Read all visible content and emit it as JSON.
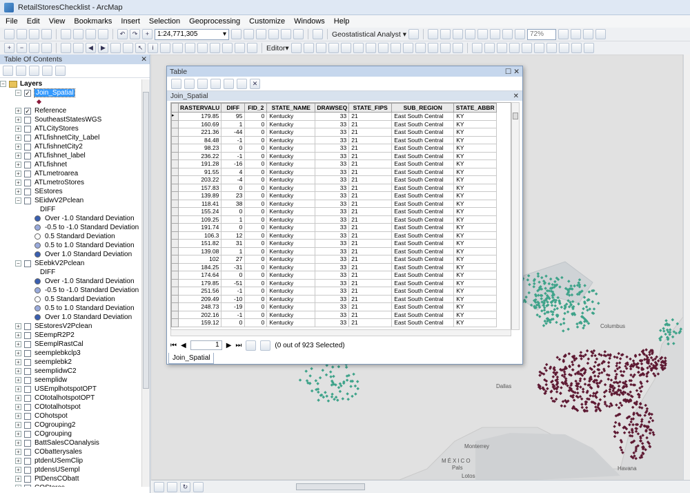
{
  "window": {
    "title": "RetailStoresChecklist - ArcMap"
  },
  "menu": [
    "File",
    "Edit",
    "View",
    "Bookmarks",
    "Insert",
    "Selection",
    "Geoprocessing",
    "Customize",
    "Windows",
    "Help"
  ],
  "toolbar": {
    "scale": "1:24,771,305",
    "geostat_label": "Geostatistical Analyst ▾",
    "zoom_percent": "72%",
    "editor_label": "Editor▾"
  },
  "toc": {
    "title": "Table Of Contents",
    "items": [
      {
        "label": "Layers",
        "kind": "group",
        "bold": true
      },
      {
        "label": "Join_Spatial",
        "kind": "layer",
        "checked": true,
        "expanded": true,
        "selected": true,
        "indent": 1
      },
      {
        "label": "",
        "kind": "point-symbol",
        "color": "#8b1a3a",
        "indent": 3
      },
      {
        "label": "Reference",
        "kind": "layer",
        "checked": true,
        "indent": 1
      },
      {
        "label": "SoutheastStatesWGS",
        "kind": "layer",
        "indent": 1
      },
      {
        "label": "ATLCityStores",
        "kind": "layer",
        "indent": 1
      },
      {
        "label": "ATLfishnetCity_Label",
        "kind": "layer",
        "indent": 1
      },
      {
        "label": "ATLfishnetCity2",
        "kind": "layer",
        "indent": 1
      },
      {
        "label": "ATLfishnet_label",
        "kind": "layer",
        "indent": 1
      },
      {
        "label": "ATLfishnet",
        "kind": "layer",
        "indent": 1
      },
      {
        "label": "ATLmetroarea",
        "kind": "layer",
        "indent": 1
      },
      {
        "label": "ATLmetroStores",
        "kind": "layer",
        "indent": 1
      },
      {
        "label": "SEstores",
        "kind": "layer",
        "indent": 1
      },
      {
        "label": "SEidwV2Pclean",
        "kind": "layer",
        "expanded": true,
        "indent": 1
      },
      {
        "label": "DIFF",
        "kind": "header",
        "indent": 3
      },
      {
        "label": "Over -1.0 Standard Deviation",
        "kind": "legend",
        "color": "#3a5fb0",
        "indent": 3
      },
      {
        "label": "-0.5 to -1.0 Standard Deviation",
        "kind": "legend",
        "color": "#9aabdc",
        "indent": 3
      },
      {
        "label": "0.5 Standard Deviation",
        "kind": "legend",
        "color": "#ffffff",
        "indent": 3
      },
      {
        "label": "0.5 to 1.0 Standard Deviation",
        "kind": "legend",
        "color": "#9aabdc",
        "indent": 3
      },
      {
        "label": "Over 1.0 Standard Deviation",
        "kind": "legend",
        "color": "#3a5fb0",
        "indent": 3
      },
      {
        "label": "SEebkV2Pclean",
        "kind": "layer",
        "expanded": true,
        "indent": 1
      },
      {
        "label": "DIFF",
        "kind": "header",
        "indent": 3
      },
      {
        "label": "Over -1.0 Standard Deviation",
        "kind": "legend",
        "color": "#3a5fb0",
        "indent": 3
      },
      {
        "label": "-0.5 to -1.0 Standard Deviation",
        "kind": "legend",
        "color": "#9aabdc",
        "indent": 3
      },
      {
        "label": "0.5 Standard Deviation",
        "kind": "legend",
        "color": "#ffffff",
        "indent": 3
      },
      {
        "label": "0.5  to 1.0 Standard Deviation",
        "kind": "legend",
        "color": "#9aabdc",
        "indent": 3
      },
      {
        "label": "Over 1.0 Standard Deviation",
        "kind": "legend",
        "color": "#3a5fb0",
        "indent": 3
      },
      {
        "label": "SEstoresV2Pclean",
        "kind": "layer",
        "indent": 1
      },
      {
        "label": "SEempR2P2",
        "kind": "layer",
        "indent": 1
      },
      {
        "label": "SEemplRastCal",
        "kind": "layer",
        "indent": 1
      },
      {
        "label": "seemplebkclp3",
        "kind": "layer",
        "indent": 1
      },
      {
        "label": "seemplebk2",
        "kind": "layer",
        "indent": 1
      },
      {
        "label": "seempIidwC2",
        "kind": "layer",
        "indent": 1
      },
      {
        "label": "seemplidw",
        "kind": "layer",
        "indent": 1
      },
      {
        "label": "USEmplhotspotOPT",
        "kind": "layer",
        "indent": 1
      },
      {
        "label": "COtotalhotspotOPT",
        "kind": "layer",
        "indent": 1
      },
      {
        "label": "COtotalhotspot",
        "kind": "layer",
        "indent": 1
      },
      {
        "label": "COhotspot",
        "kind": "layer",
        "indent": 1
      },
      {
        "label": "COgrouping2",
        "kind": "layer",
        "indent": 1
      },
      {
        "label": "COgrouping",
        "kind": "layer",
        "indent": 1
      },
      {
        "label": "BattSalesCOanalysis",
        "kind": "layer",
        "indent": 1
      },
      {
        "label": "CObatterysales",
        "kind": "layer",
        "indent": 1
      },
      {
        "label": "ptdenUSemClip",
        "kind": "layer",
        "indent": 1
      },
      {
        "label": "ptdensUSempl",
        "kind": "layer",
        "indent": 1
      },
      {
        "label": "PtDensCObatt",
        "kind": "layer",
        "indent": 1
      },
      {
        "label": "COStores",
        "kind": "layer",
        "indent": 1
      }
    ]
  },
  "map": {
    "labels": [
      "Columbus",
      "Dallas",
      "Monterrey",
      "MÉXICO",
      "Havana",
      "Pals",
      "Lotos"
    ],
    "colors": {
      "east_points": "#5e1a33",
      "west_points": "#3fa38a",
      "background": "#d9dadb",
      "land": "#e1e1e1"
    }
  },
  "table": {
    "window_title": "Table",
    "layer_name": "Join_Spatial",
    "columns": [
      "RASTERVALU",
      "DIFF",
      "FID_2",
      "STATE_NAME",
      "DRAWSEQ",
      "STATE_FIPS",
      "SUB_REGION",
      "STATE_ABBR"
    ],
    "rows": [
      [
        "179.85",
        "95",
        "0",
        "Kentucky",
        "33",
        "21",
        "East South Central",
        "KY"
      ],
      [
        "160.69",
        "1",
        "0",
        "Kentucky",
        "33",
        "21",
        "East South Central",
        "KY"
      ],
      [
        "221.36",
        "-44",
        "0",
        "Kentucky",
        "33",
        "21",
        "East South Central",
        "KY"
      ],
      [
        "84.48",
        "-1",
        "0",
        "Kentucky",
        "33",
        "21",
        "East South Central",
        "KY"
      ],
      [
        "98.23",
        "0",
        "0",
        "Kentucky",
        "33",
        "21",
        "East South Central",
        "KY"
      ],
      [
        "236.22",
        "-1",
        "0",
        "Kentucky",
        "33",
        "21",
        "East South Central",
        "KY"
      ],
      [
        "191.28",
        "-16",
        "0",
        "Kentucky",
        "33",
        "21",
        "East South Central",
        "KY"
      ],
      [
        "91.55",
        "4",
        "0",
        "Kentucky",
        "33",
        "21",
        "East South Central",
        "KY"
      ],
      [
        "203.22",
        "-4",
        "0",
        "Kentucky",
        "33",
        "21",
        "East South Central",
        "KY"
      ],
      [
        "157.83",
        "0",
        "0",
        "Kentucky",
        "33",
        "21",
        "East South Central",
        "KY"
      ],
      [
        "139.89",
        "23",
        "0",
        "Kentucky",
        "33",
        "21",
        "East South Central",
        "KY"
      ],
      [
        "118.41",
        "38",
        "0",
        "Kentucky",
        "33",
        "21",
        "East South Central",
        "KY"
      ],
      [
        "155.24",
        "0",
        "0",
        "Kentucky",
        "33",
        "21",
        "East South Central",
        "KY"
      ],
      [
        "109.25",
        "1",
        "0",
        "Kentucky",
        "33",
        "21",
        "East South Central",
        "KY"
      ],
      [
        "191.74",
        "0",
        "0",
        "Kentucky",
        "33",
        "21",
        "East South Central",
        "KY"
      ],
      [
        "106.3",
        "12",
        "0",
        "Kentucky",
        "33",
        "21",
        "East South Central",
        "KY"
      ],
      [
        "151.82",
        "31",
        "0",
        "Kentucky",
        "33",
        "21",
        "East South Central",
        "KY"
      ],
      [
        "139.08",
        "1",
        "0",
        "Kentucky",
        "33",
        "21",
        "East South Central",
        "KY"
      ],
      [
        "102",
        "27",
        "0",
        "Kentucky",
        "33",
        "21",
        "East South Central",
        "KY"
      ],
      [
        "184.25",
        "-31",
        "0",
        "Kentucky",
        "33",
        "21",
        "East South Central",
        "KY"
      ],
      [
        "174.64",
        "0",
        "0",
        "Kentucky",
        "33",
        "21",
        "East South Central",
        "KY"
      ],
      [
        "179.85",
        "-51",
        "0",
        "Kentucky",
        "33",
        "21",
        "East South Central",
        "KY"
      ],
      [
        "251.56",
        "-1",
        "0",
        "Kentucky",
        "33",
        "21",
        "East South Central",
        "KY"
      ],
      [
        "209.49",
        "-10",
        "0",
        "Kentucky",
        "33",
        "21",
        "East South Central",
        "KY"
      ],
      [
        "248.73",
        "-19",
        "0",
        "Kentucky",
        "33",
        "21",
        "East South Central",
        "KY"
      ],
      [
        "202.16",
        "-1",
        "0",
        "Kentucky",
        "33",
        "21",
        "East South Central",
        "KY"
      ],
      [
        "159.12",
        "0",
        "0",
        "Kentucky",
        "33",
        "21",
        "East South Central",
        "KY"
      ]
    ],
    "page": "1",
    "selection_status": "(0 out of 923 Selected)",
    "tab_label": "Join_Spatial"
  }
}
